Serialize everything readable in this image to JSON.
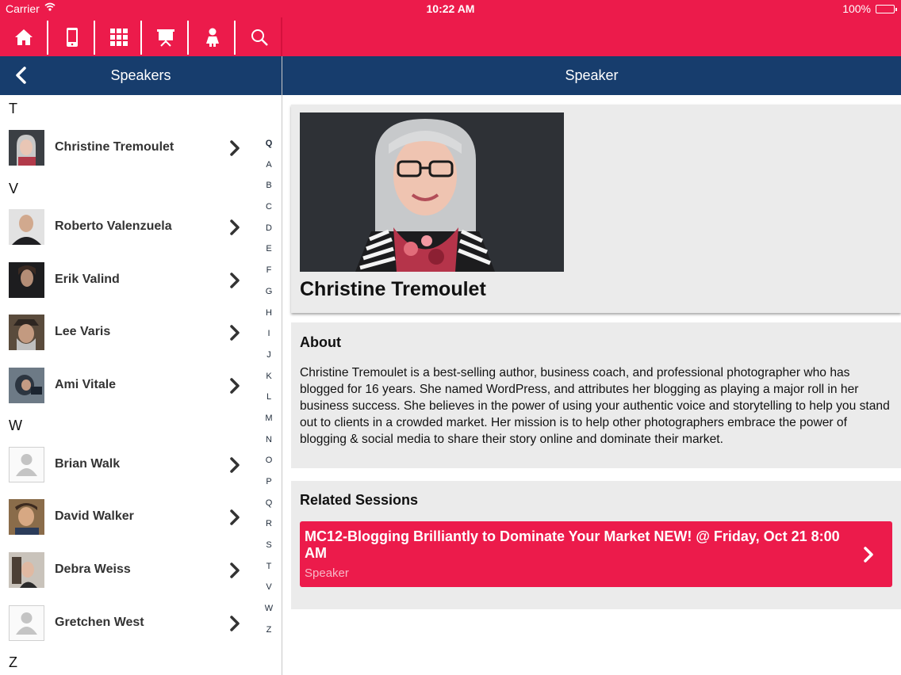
{
  "status_bar": {
    "carrier": "Carrier",
    "time": "10:22 AM",
    "battery": "100%"
  },
  "toolbar": {
    "icons": [
      "home-icon",
      "phone-icon",
      "grid-icon",
      "presentation-icon",
      "person-icon",
      "search-icon"
    ]
  },
  "left_nav": {
    "title": "Speakers",
    "back_icon": "chevron-left-icon"
  },
  "right_nav": {
    "title": "Speaker"
  },
  "speaker_list": {
    "sections": [
      {
        "letter": "T",
        "speakers": [
          "Christine Tremoulet"
        ]
      },
      {
        "letter": "V",
        "speakers": [
          "Roberto Valenzuela",
          "Erik Valind",
          "Lee Varis",
          "Ami Vitale"
        ]
      },
      {
        "letter": "W",
        "speakers": [
          "Brian Walk",
          "David Walker",
          "Debra Weiss",
          "Gretchen West"
        ]
      },
      {
        "letter": "Z",
        "speakers": []
      }
    ]
  },
  "index_letters": [
    "Q",
    "A",
    "B",
    "C",
    "D",
    "E",
    "F",
    "G",
    "H",
    "I",
    "J",
    "K",
    "L",
    "M",
    "N",
    "O",
    "P",
    "Q",
    "R",
    "S",
    "T",
    "V",
    "W",
    "Z"
  ],
  "speaker": {
    "name": "Christine Tremoulet",
    "about_title": "About",
    "about_text": "Christine Tremoulet is a best-selling author, business coach, and professional photographer who has blogged for 16 years. She named WordPress, and attributes her blogging as playing a major roll in her business success. She believes in the power of using your authentic voice and storytelling to help you stand out to clients in a crowded market. Her mission is to help other photographers embrace the power of blogging & social media to share their story online and dominate their market.",
    "sessions_title": "Related Sessions",
    "sessions": [
      {
        "title": "MC12-Blogging Brilliantly to Dominate Your Market NEW! @ Friday, Oct 21 8:00 AM",
        "role": "Speaker"
      }
    ]
  },
  "colors": {
    "accent": "#ec1b4b",
    "navbar": "#173d6d",
    "card": "#ebebeb"
  }
}
